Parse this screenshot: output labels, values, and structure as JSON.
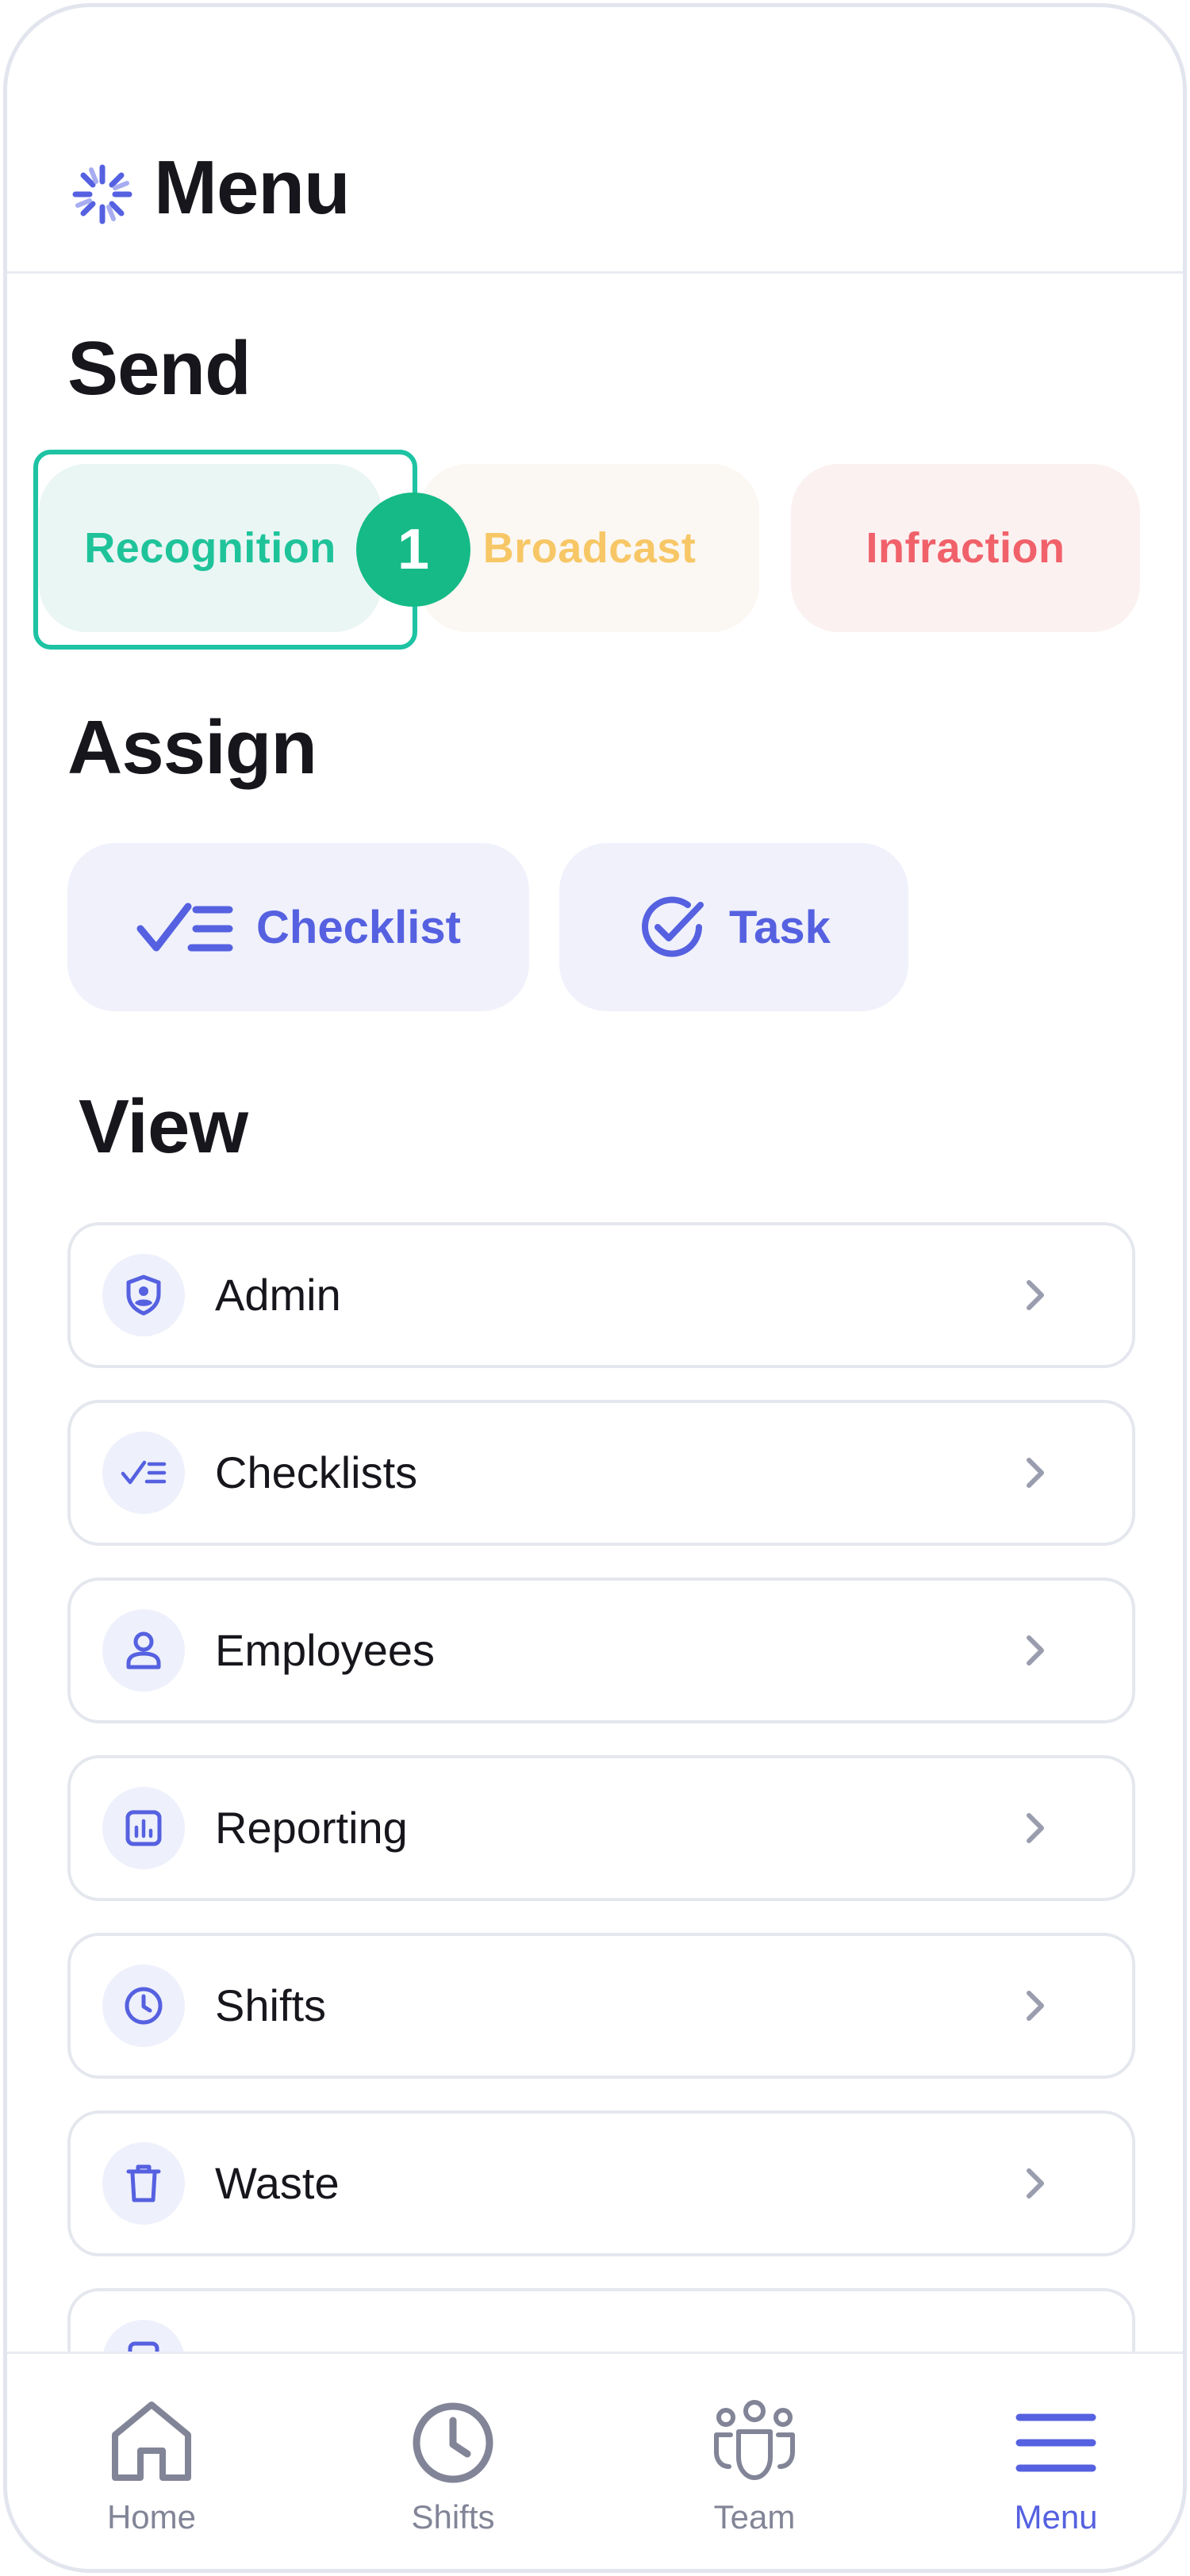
{
  "header": {
    "title": "Menu",
    "logo_icon": "sparkle-logo-icon"
  },
  "send": {
    "title": "Send",
    "items": [
      {
        "label": "Recognition",
        "color": "#1fc39a"
      },
      {
        "label": "Broadcast",
        "color": "#f7c766"
      },
      {
        "label": "Infraction",
        "color": "#f0616a"
      }
    ],
    "step_badge": "1",
    "highlight_color": "#1dc3a3"
  },
  "assign": {
    "title": "Assign",
    "items": [
      {
        "label": "Checklist",
        "icon": "checklist-icon"
      },
      {
        "label": "Task",
        "icon": "check-circle-icon"
      }
    ]
  },
  "view": {
    "title": "View",
    "items": [
      {
        "label": "Admin",
        "icon": "shield-user-icon"
      },
      {
        "label": "Checklists",
        "icon": "checklist-icon"
      },
      {
        "label": "Employees",
        "icon": "user-icon"
      },
      {
        "label": "Reporting",
        "icon": "bar-chart-icon"
      },
      {
        "label": "Shifts",
        "icon": "clock-icon"
      },
      {
        "label": "Waste",
        "icon": "trash-icon"
      }
    ]
  },
  "tabbar": {
    "items": [
      {
        "label": "Home",
        "icon": "home-icon"
      },
      {
        "label": "Shifts",
        "icon": "clock-icon"
      },
      {
        "label": "Team",
        "icon": "team-icon"
      },
      {
        "label": "Menu",
        "icon": "menu-icon",
        "active": true
      }
    ]
  },
  "colors": {
    "accent": "#5561e0",
    "muted": "#828597",
    "border": "#e5e7ee"
  }
}
